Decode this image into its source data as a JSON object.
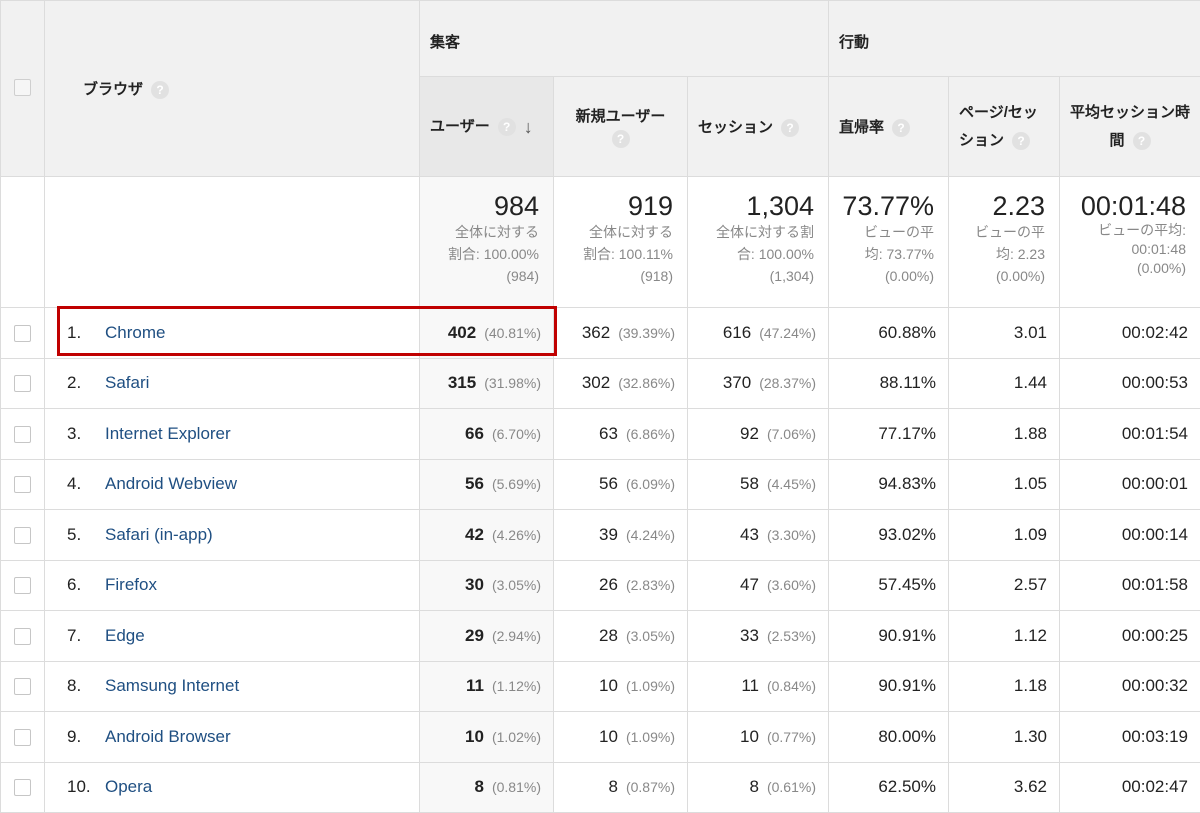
{
  "header": {
    "dimension": "ブラウザ",
    "group_acquisition": "集客",
    "group_behavior": "行動",
    "metrics": [
      {
        "label": "ユーザー",
        "sorted": true
      },
      {
        "label": "新規ユーザー"
      },
      {
        "label": "セッション"
      },
      {
        "label": "直帰率"
      },
      {
        "label": "ページ/セッション"
      },
      {
        "label": "平均セッション時間"
      }
    ],
    "help_glyph": "?",
    "sort_glyph": "↓"
  },
  "totals": {
    "users": {
      "value": "984",
      "line1": "全体に対する",
      "line2": "割合: 100.00%",
      "line3": "(984)"
    },
    "new_users": {
      "value": "919",
      "line1": "全体に対する",
      "line2": "割合: 100.11%",
      "line3": "(918)"
    },
    "sessions": {
      "value": "1,304",
      "line1": "全体に対する割",
      "line2": "合: 100.00%",
      "line3": "(1,304)"
    },
    "bounce": {
      "value": "73.77%",
      "line1": "ビューの平",
      "line2": "均: 73.77%",
      "line3": "(0.00%)"
    },
    "pages": {
      "value": "2.23",
      "line1": "ビューの平",
      "line2": "均: 2.23",
      "line3": "(0.00%)"
    },
    "duration": {
      "value": "00:01:48",
      "line1": "ビューの平均:",
      "line2": "00:01:48",
      "line3": "(0.00%)"
    }
  },
  "rows": [
    {
      "idx": "1.",
      "name": "Chrome",
      "users": "402",
      "users_pct": "(40.81%)",
      "new": "362",
      "new_pct": "(39.39%)",
      "sess": "616",
      "sess_pct": "(47.24%)",
      "bounce": "60.88%",
      "pages": "3.01",
      "dur": "00:02:42"
    },
    {
      "idx": "2.",
      "name": "Safari",
      "users": "315",
      "users_pct": "(31.98%)",
      "new": "302",
      "new_pct": "(32.86%)",
      "sess": "370",
      "sess_pct": "(28.37%)",
      "bounce": "88.11%",
      "pages": "1.44",
      "dur": "00:00:53"
    },
    {
      "idx": "3.",
      "name": "Internet Explorer",
      "users": "66",
      "users_pct": "(6.70%)",
      "new": "63",
      "new_pct": "(6.86%)",
      "sess": "92",
      "sess_pct": "(7.06%)",
      "bounce": "77.17%",
      "pages": "1.88",
      "dur": "00:01:54"
    },
    {
      "idx": "4.",
      "name": "Android Webview",
      "users": "56",
      "users_pct": "(5.69%)",
      "new": "56",
      "new_pct": "(6.09%)",
      "sess": "58",
      "sess_pct": "(4.45%)",
      "bounce": "94.83%",
      "pages": "1.05",
      "dur": "00:00:01"
    },
    {
      "idx": "5.",
      "name": "Safari (in-app)",
      "users": "42",
      "users_pct": "(4.26%)",
      "new": "39",
      "new_pct": "(4.24%)",
      "sess": "43",
      "sess_pct": "(3.30%)",
      "bounce": "93.02%",
      "pages": "1.09",
      "dur": "00:00:14"
    },
    {
      "idx": "6.",
      "name": "Firefox",
      "users": "30",
      "users_pct": "(3.05%)",
      "new": "26",
      "new_pct": "(2.83%)",
      "sess": "47",
      "sess_pct": "(3.60%)",
      "bounce": "57.45%",
      "pages": "2.57",
      "dur": "00:01:58"
    },
    {
      "idx": "7.",
      "name": "Edge",
      "users": "29",
      "users_pct": "(2.94%)",
      "new": "28",
      "new_pct": "(3.05%)",
      "sess": "33",
      "sess_pct": "(2.53%)",
      "bounce": "90.91%",
      "pages": "1.12",
      "dur": "00:00:25"
    },
    {
      "idx": "8.",
      "name": "Samsung Internet",
      "users": "11",
      "users_pct": "(1.12%)",
      "new": "10",
      "new_pct": "(1.09%)",
      "sess": "11",
      "sess_pct": "(0.84%)",
      "bounce": "90.91%",
      "pages": "1.18",
      "dur": "00:00:32"
    },
    {
      "idx": "9.",
      "name": "Android Browser",
      "users": "10",
      "users_pct": "(1.02%)",
      "new": "10",
      "new_pct": "(1.09%)",
      "sess": "10",
      "sess_pct": "(0.77%)",
      "bounce": "80.00%",
      "pages": "1.30",
      "dur": "00:03:19"
    },
    {
      "idx": "10.",
      "name": "Opera",
      "users": "8",
      "users_pct": "(0.81%)",
      "new": "8",
      "new_pct": "(0.87%)",
      "sess": "8",
      "sess_pct": "(0.61%)",
      "bounce": "62.50%",
      "pages": "3.62",
      "dur": "00:02:47"
    }
  ],
  "colors": {
    "link": "#1f4f82",
    "highlight": "#c00000",
    "header_bg": "#f1f1f1"
  }
}
